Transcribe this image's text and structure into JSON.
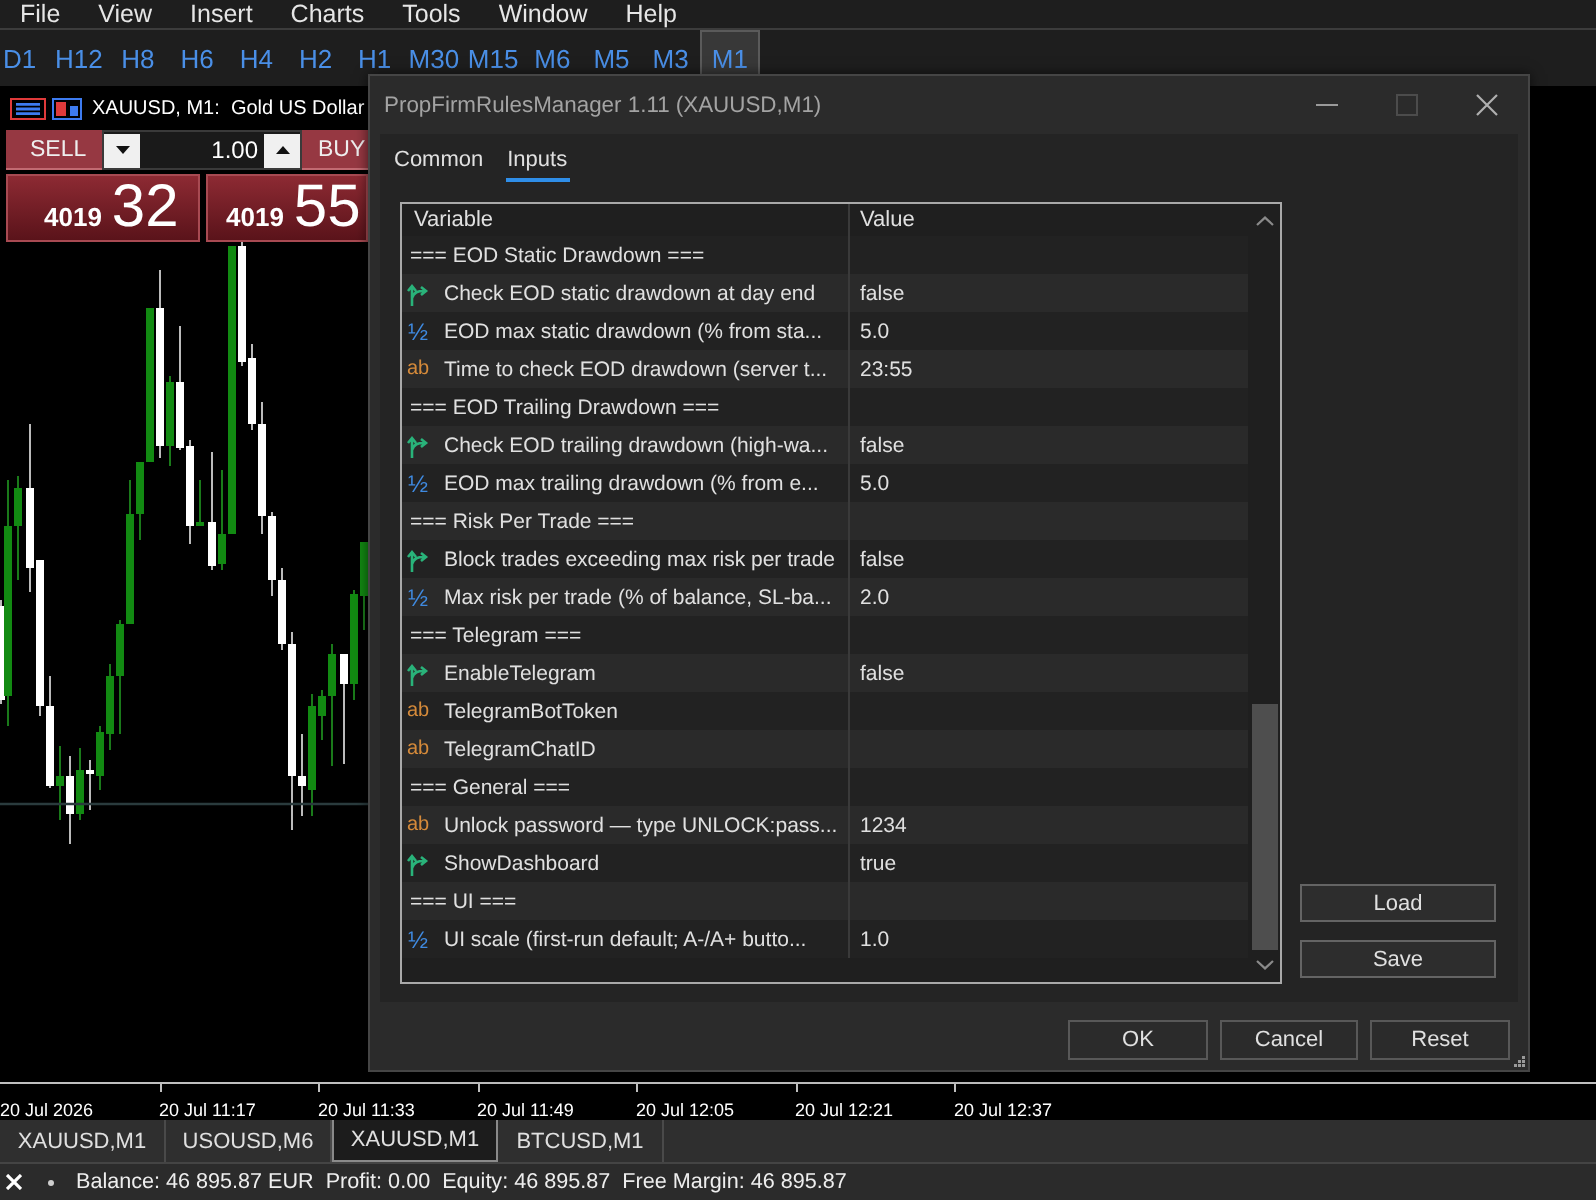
{
  "menu": [
    "File",
    "View",
    "Insert",
    "Charts",
    "Tools",
    "Window",
    "Help"
  ],
  "timeframes": [
    {
      "label": "D1",
      "selected": false
    },
    {
      "label": "H12",
      "selected": false
    },
    {
      "label": "H8",
      "selected": false
    },
    {
      "label": "H6",
      "selected": false
    },
    {
      "label": "H4",
      "selected": false
    },
    {
      "label": "H2",
      "selected": false
    },
    {
      "label": "H1",
      "selected": false
    },
    {
      "label": "M30",
      "selected": false
    },
    {
      "label": "M15",
      "selected": false
    },
    {
      "label": "M6",
      "selected": false
    },
    {
      "label": "M5",
      "selected": false
    },
    {
      "label": "M3",
      "selected": false
    },
    {
      "label": "M1",
      "selected": true
    }
  ],
  "chart": {
    "title": "XAUUSD, M1:  Gold US Dollar",
    "trade_panel": {
      "sell": "SELL",
      "buy": "BUY",
      "lot": "1.00",
      "bid": {
        "small": "4019",
        "big": "32"
      },
      "ask": {
        "small": "4019",
        "big": "55"
      }
    }
  },
  "time_axis": [
    "20 Jul 2026",
    "20 Jul 11:17",
    "20 Jul 11:33",
    "20 Jul 11:49",
    "20 Jul 12:05",
    "20 Jul 12:21",
    "20 Jul 12:37"
  ],
  "chart_tabs": [
    {
      "label": "XAUUSD,M1",
      "selected": false
    },
    {
      "label": "USOUSD,M6",
      "selected": false
    },
    {
      "label": "XAUUSD,M1",
      "selected": true
    },
    {
      "label": "BTCUSD,M1",
      "selected": false
    }
  ],
  "status_bar": {
    "items": [
      "Balance: 46 895.87 EUR",
      "Profit: 0.00",
      "Equity: 46 895.87",
      "Free Margin: 46 895.87"
    ]
  },
  "dialog": {
    "title": "PropFirmRulesManager 1.11 (XAUUSD,M1)",
    "maximize": {
      "disabled": true
    },
    "tabs": [
      {
        "label": "Common",
        "selected": false
      },
      {
        "label": "Inputs",
        "selected": true
      }
    ],
    "table": {
      "columns": [
        "Variable",
        "Value"
      ],
      "rows": [
        {
          "kind": "section",
          "variable": "=== EOD Static Drawdown ==="
        },
        {
          "kind": "bool",
          "variable": "Check EOD static drawdown at day end",
          "value": "false"
        },
        {
          "kind": "double",
          "type_icon": "½",
          "variable": "EOD max static drawdown (% from sta...",
          "value": "5.0"
        },
        {
          "kind": "string",
          "type_icon": "ab",
          "variable": "Time to check EOD drawdown (server t...",
          "value": "23:55"
        },
        {
          "kind": "section",
          "variable": "=== EOD Trailing Drawdown ==="
        },
        {
          "kind": "bool",
          "variable": "Check EOD trailing drawdown (high-wa...",
          "value": "false"
        },
        {
          "kind": "double",
          "type_icon": "½",
          "variable": "EOD max trailing drawdown (% from e...",
          "value": "5.0"
        },
        {
          "kind": "section",
          "variable": "=== Risk Per Trade ==="
        },
        {
          "kind": "bool",
          "variable": "Block trades exceeding max risk per trade",
          "value": "false"
        },
        {
          "kind": "double",
          "type_icon": "½",
          "variable": "Max risk per trade (% of balance, SL-ba...",
          "value": "2.0"
        },
        {
          "kind": "section",
          "variable": "=== Telegram ==="
        },
        {
          "kind": "bool",
          "variable": "EnableTelegram",
          "value": "false"
        },
        {
          "kind": "string",
          "type_icon": "ab",
          "variable": "TelegramBotToken"
        },
        {
          "kind": "string",
          "type_icon": "ab",
          "variable": "TelegramChatID"
        },
        {
          "kind": "section",
          "variable": "=== General ==="
        },
        {
          "kind": "string",
          "type_icon": "ab",
          "variable": "Unlock password — type UNLOCK:pass...",
          "value": "1234"
        },
        {
          "kind": "bool",
          "variable": "ShowDashboard",
          "value": "true"
        },
        {
          "kind": "section",
          "variable": "=== UI ==="
        },
        {
          "kind": "double",
          "type_icon": "½",
          "variable": "UI scale (first-run default; A-/A+ butto...",
          "value": "1.0"
        }
      ]
    },
    "side_buttons": [
      "Load",
      "Save"
    ],
    "buttons": [
      "OK",
      "Cancel",
      "Reset"
    ]
  }
}
